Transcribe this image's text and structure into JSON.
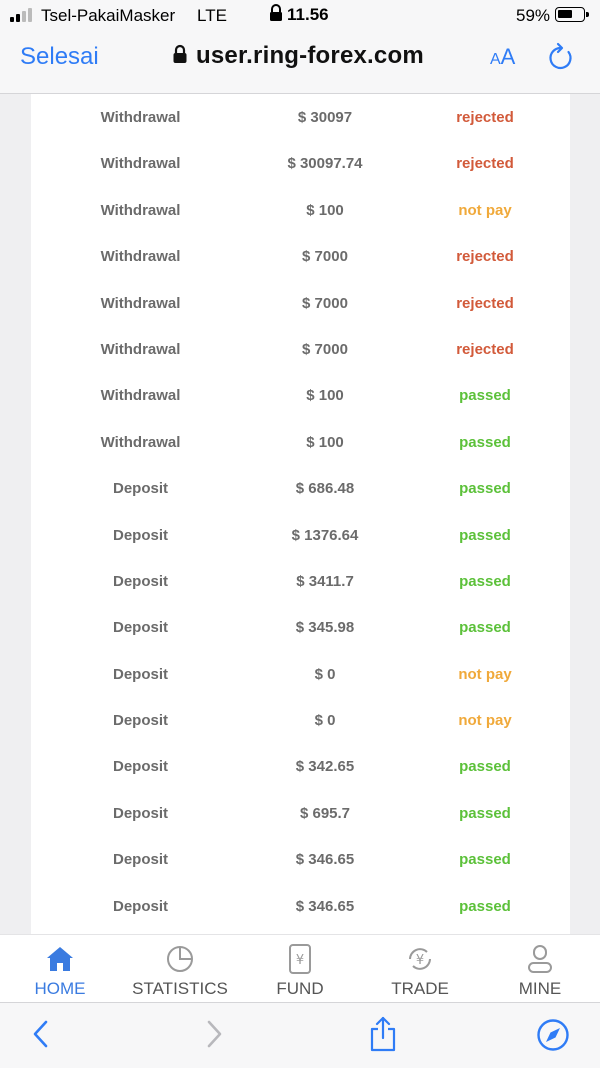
{
  "status_bar": {
    "carrier": "Tsel-PakaiMasker",
    "network": "LTE",
    "time": "11.56",
    "battery": "59%",
    "battery_level": 0.59
  },
  "browser": {
    "done_label": "Selesai",
    "url": "user.ring-forex.com",
    "text_size_small": "A",
    "text_size_big": "A"
  },
  "colors": {
    "accent": "#2f7cf6",
    "rejected": "#d25a3a",
    "not_pay": "#f0a93a",
    "passed": "#5cc13a",
    "active_tab": "#3a7be0"
  },
  "transactions": [
    {
      "type": "Withdrawal",
      "amount": "$ 30097",
      "status": "rejected"
    },
    {
      "type": "Withdrawal",
      "amount": "$ 30097.74",
      "status": "rejected"
    },
    {
      "type": "Withdrawal",
      "amount": "$ 100",
      "status": "not pay"
    },
    {
      "type": "Withdrawal",
      "amount": "$ 7000",
      "status": "rejected"
    },
    {
      "type": "Withdrawal",
      "amount": "$ 7000",
      "status": "rejected"
    },
    {
      "type": "Withdrawal",
      "amount": "$ 7000",
      "status": "rejected"
    },
    {
      "type": "Withdrawal",
      "amount": "$ 100",
      "status": "passed"
    },
    {
      "type": "Withdrawal",
      "amount": "$ 100",
      "status": "passed"
    },
    {
      "type": "Deposit",
      "amount": "$ 686.48",
      "status": "passed"
    },
    {
      "type": "Deposit",
      "amount": "$ 1376.64",
      "status": "passed"
    },
    {
      "type": "Deposit",
      "amount": "$ 3411.7",
      "status": "passed"
    },
    {
      "type": "Deposit",
      "amount": "$ 345.98",
      "status": "passed"
    },
    {
      "type": "Deposit",
      "amount": "$ 0",
      "status": "not pay"
    },
    {
      "type": "Deposit",
      "amount": "$ 0",
      "status": "not pay"
    },
    {
      "type": "Deposit",
      "amount": "$ 342.65",
      "status": "passed"
    },
    {
      "type": "Deposit",
      "amount": "$ 695.7",
      "status": "passed"
    },
    {
      "type": "Deposit",
      "amount": "$ 346.65",
      "status": "passed"
    },
    {
      "type": "Deposit",
      "amount": "$ 346.65",
      "status": "passed"
    }
  ],
  "tabs": [
    {
      "label": "HOME",
      "icon": "home-icon",
      "active": true
    },
    {
      "label": "STATISTICS",
      "icon": "pie-chart-icon",
      "active": false
    },
    {
      "label": "FUND",
      "icon": "yen-document-icon",
      "active": false
    },
    {
      "label": "TRADE",
      "icon": "yen-exchange-icon",
      "active": false
    },
    {
      "label": "MINE",
      "icon": "user-icon",
      "active": false
    }
  ],
  "toolbar": {
    "icons": [
      "back-icon",
      "forward-icon",
      "share-icon",
      "compass-icon"
    ]
  }
}
